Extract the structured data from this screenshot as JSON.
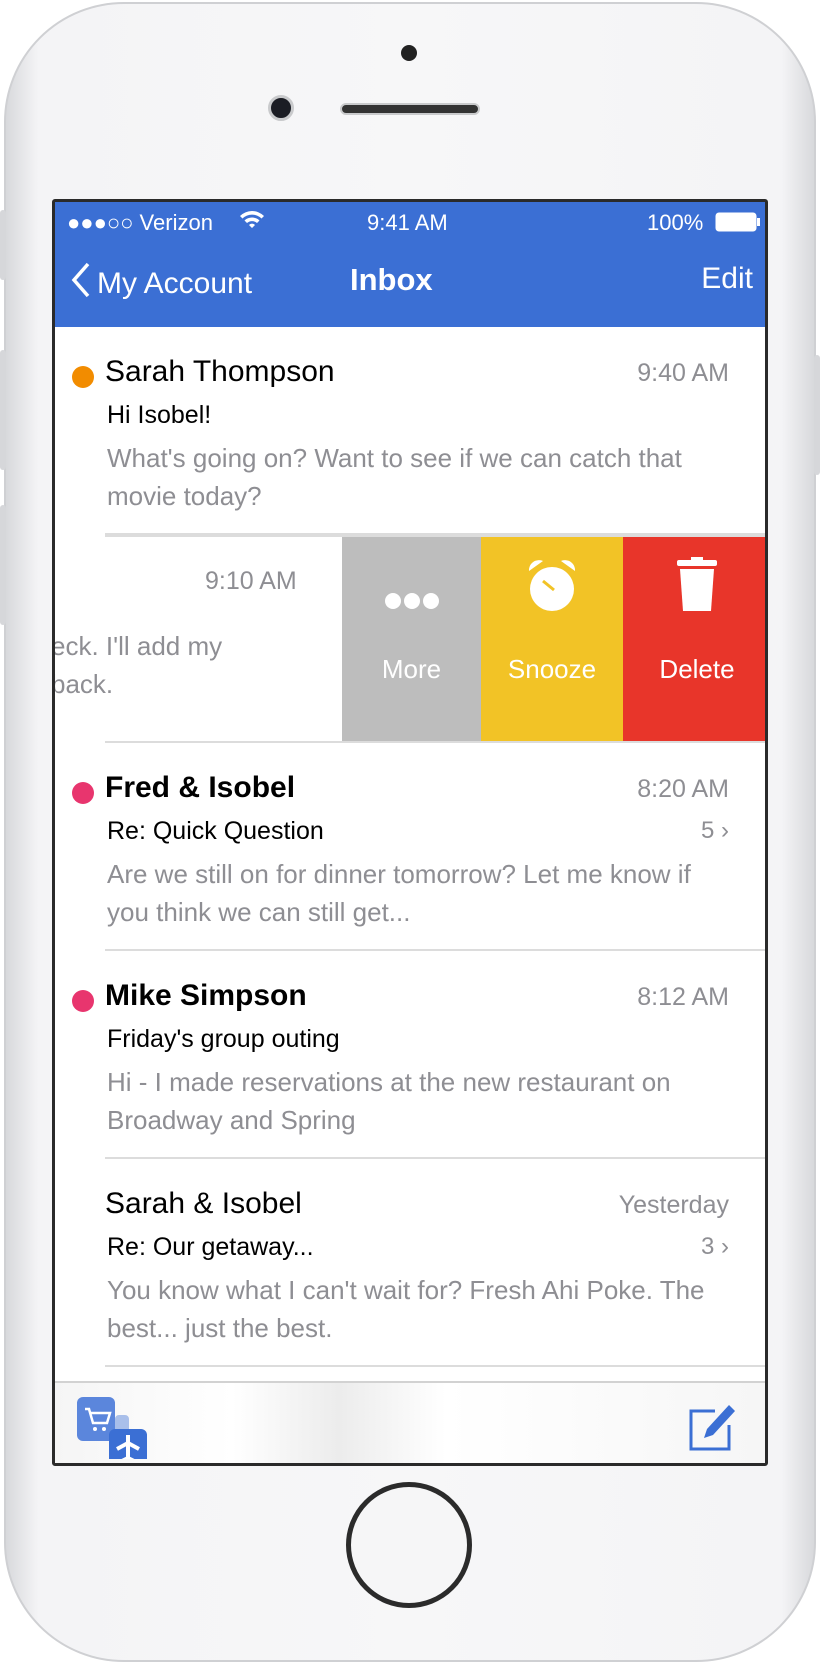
{
  "status_bar": {
    "carrier": "●●●○○ Verizon",
    "time": "9:41 AM",
    "battery": "100%"
  },
  "nav": {
    "back_label": "My Account",
    "title": "Inbox",
    "edit_label": "Edit"
  },
  "messages": [
    {
      "sender": "Sarah Thompson",
      "time": "9:40 AM",
      "subject": "Hi Isobel!",
      "preview": "What's going on? Want to see if we can catch that movie today?",
      "unread_color": "#f28c00",
      "bold": false
    },
    {
      "time": "9:10 AM",
      "preview_line1": "eck. I'll add my",
      "preview_line2": "back."
    },
    {
      "sender": "Fred & Isobel",
      "time": "8:20 AM",
      "subject": "Re: Quick Question",
      "count": "5",
      "preview": "Are we still on for dinner tomorrow? Let me know if you think we can still get...",
      "unread_color": "#e8356e",
      "bold": true
    },
    {
      "sender": "Mike Simpson",
      "time": "8:12 AM",
      "subject": "Friday's group outing",
      "preview": "Hi - I made reservations at the new restaurant on Broadway and Spring",
      "unread_color": "#e8356e",
      "bold": true
    },
    {
      "sender": "Sarah & Isobel",
      "time": "Yesterday",
      "subject": "Re: Our getaway...",
      "count": "3",
      "preview": "You know what I can't wait for? Fresh Ahi Poke. The best... just the best.",
      "bold": false
    }
  ],
  "swipe_actions": [
    {
      "label": "More",
      "icon": "more-dots-icon",
      "color": "#bdbdbd"
    },
    {
      "label": "Snooze",
      "icon": "alarm-clock-icon",
      "color": "#f2c326"
    },
    {
      "label": "Delete",
      "icon": "trash-icon",
      "color": "#e8352a"
    }
  ],
  "toolbar": {
    "left_icon": "app-switcher-icon",
    "right_icon": "compose-icon"
  },
  "colors": {
    "accent": "#3b6fd4"
  }
}
